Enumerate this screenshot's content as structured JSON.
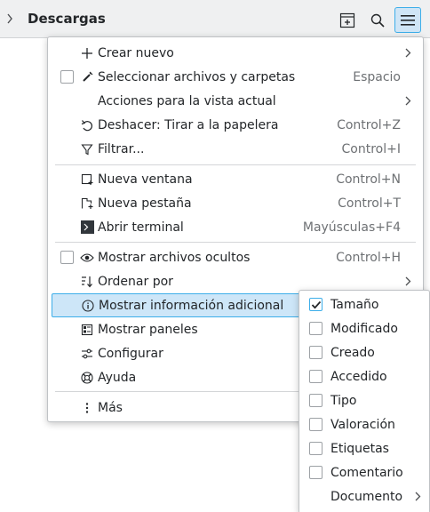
{
  "toolbar": {
    "title": "Descargas"
  },
  "menu": {
    "crear_nuevo": "Crear nuevo",
    "seleccionar": "Seleccionar archivos y carpetas",
    "seleccionar_sc": "Espacio",
    "acciones": "Acciones para la vista actual",
    "deshacer": "Deshacer: Tirar a la papelera",
    "deshacer_sc": "Control+Z",
    "filtrar": "Filtrar...",
    "filtrar_sc": "Control+I",
    "nueva_ventana": "Nueva ventana",
    "nueva_ventana_sc": "Control+N",
    "nueva_pestana": "Nueva pestaña",
    "nueva_pestana_sc": "Control+T",
    "abrir_terminal": "Abrir terminal",
    "abrir_terminal_sc": "Mayúsculas+F4",
    "mostrar_ocultos": "Mostrar archivos ocultos",
    "mostrar_ocultos_sc": "Control+H",
    "ordenar_por": "Ordenar por",
    "mostrar_info": "Mostrar información adicional",
    "mostrar_paneles": "Mostrar paneles",
    "configurar": "Configurar",
    "ayuda": "Ayuda",
    "mas": "Más"
  },
  "submenu": {
    "items": [
      {
        "label": "Tamaño",
        "checked": true
      },
      {
        "label": "Modificado",
        "checked": false
      },
      {
        "label": "Creado",
        "checked": false
      },
      {
        "label": "Accedido",
        "checked": false
      },
      {
        "label": "Tipo",
        "checked": false
      },
      {
        "label": "Valoración",
        "checked": false
      },
      {
        "label": "Etiquetas",
        "checked": false
      },
      {
        "label": "Comentario",
        "checked": false
      }
    ],
    "documento": "Documento"
  },
  "colors": {
    "accent": "#3daee9",
    "highlight": "#cde6f8",
    "text": "#232629",
    "shortcut": "#6e7174"
  }
}
